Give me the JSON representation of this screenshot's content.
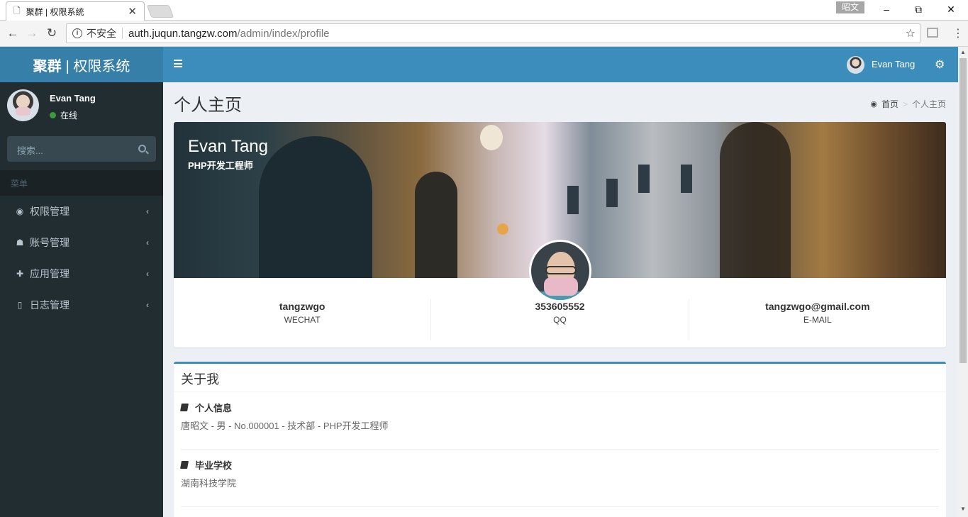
{
  "browser": {
    "tab_title": "聚群 | 权限系统",
    "user_badge": "昭文",
    "insecure_label": "不安全",
    "url_host": "auth.juqun.tangzw.com",
    "url_path": "/admin/index/profile"
  },
  "sidebar": {
    "logo_bold": "聚群",
    "logo_rest": "| 权限系统",
    "user_name": "Evan Tang",
    "user_status": "在线",
    "search_placeholder": "搜索...",
    "menu_header": "菜单",
    "items": [
      {
        "label": "权限管理",
        "icon": "dashboard-icon"
      },
      {
        "label": "账号管理",
        "icon": "users-icon"
      },
      {
        "label": "应用管理",
        "icon": "puzzle-icon"
      },
      {
        "label": "日志管理",
        "icon": "file-code-icon"
      }
    ]
  },
  "header": {
    "user_name": "Evan Tang"
  },
  "page": {
    "title": "个人主页",
    "breadcrumb_home": "首页",
    "breadcrumb_current": "个人主页"
  },
  "profile": {
    "name": "Evan Tang",
    "job": "PHP开发工程师",
    "stats": [
      {
        "value": "tangzwgo",
        "label": "WECHAT"
      },
      {
        "value": "353605552",
        "label": "QQ"
      },
      {
        "value": "tangzwgo@gmail.com",
        "label": "E-MAIL"
      }
    ]
  },
  "about": {
    "title": "关于我",
    "sections": [
      {
        "title": "个人信息",
        "value": "唐昭文 - 男 - No.000001 - 技术部 - PHP开发工程师"
      },
      {
        "title": "毕业学校",
        "value": "湖南科技学院"
      }
    ]
  },
  "colors": {
    "header": "#3c8dbc",
    "logo": "#367fa9",
    "sidebar": "#222d32",
    "online": "#3c9c3c"
  }
}
